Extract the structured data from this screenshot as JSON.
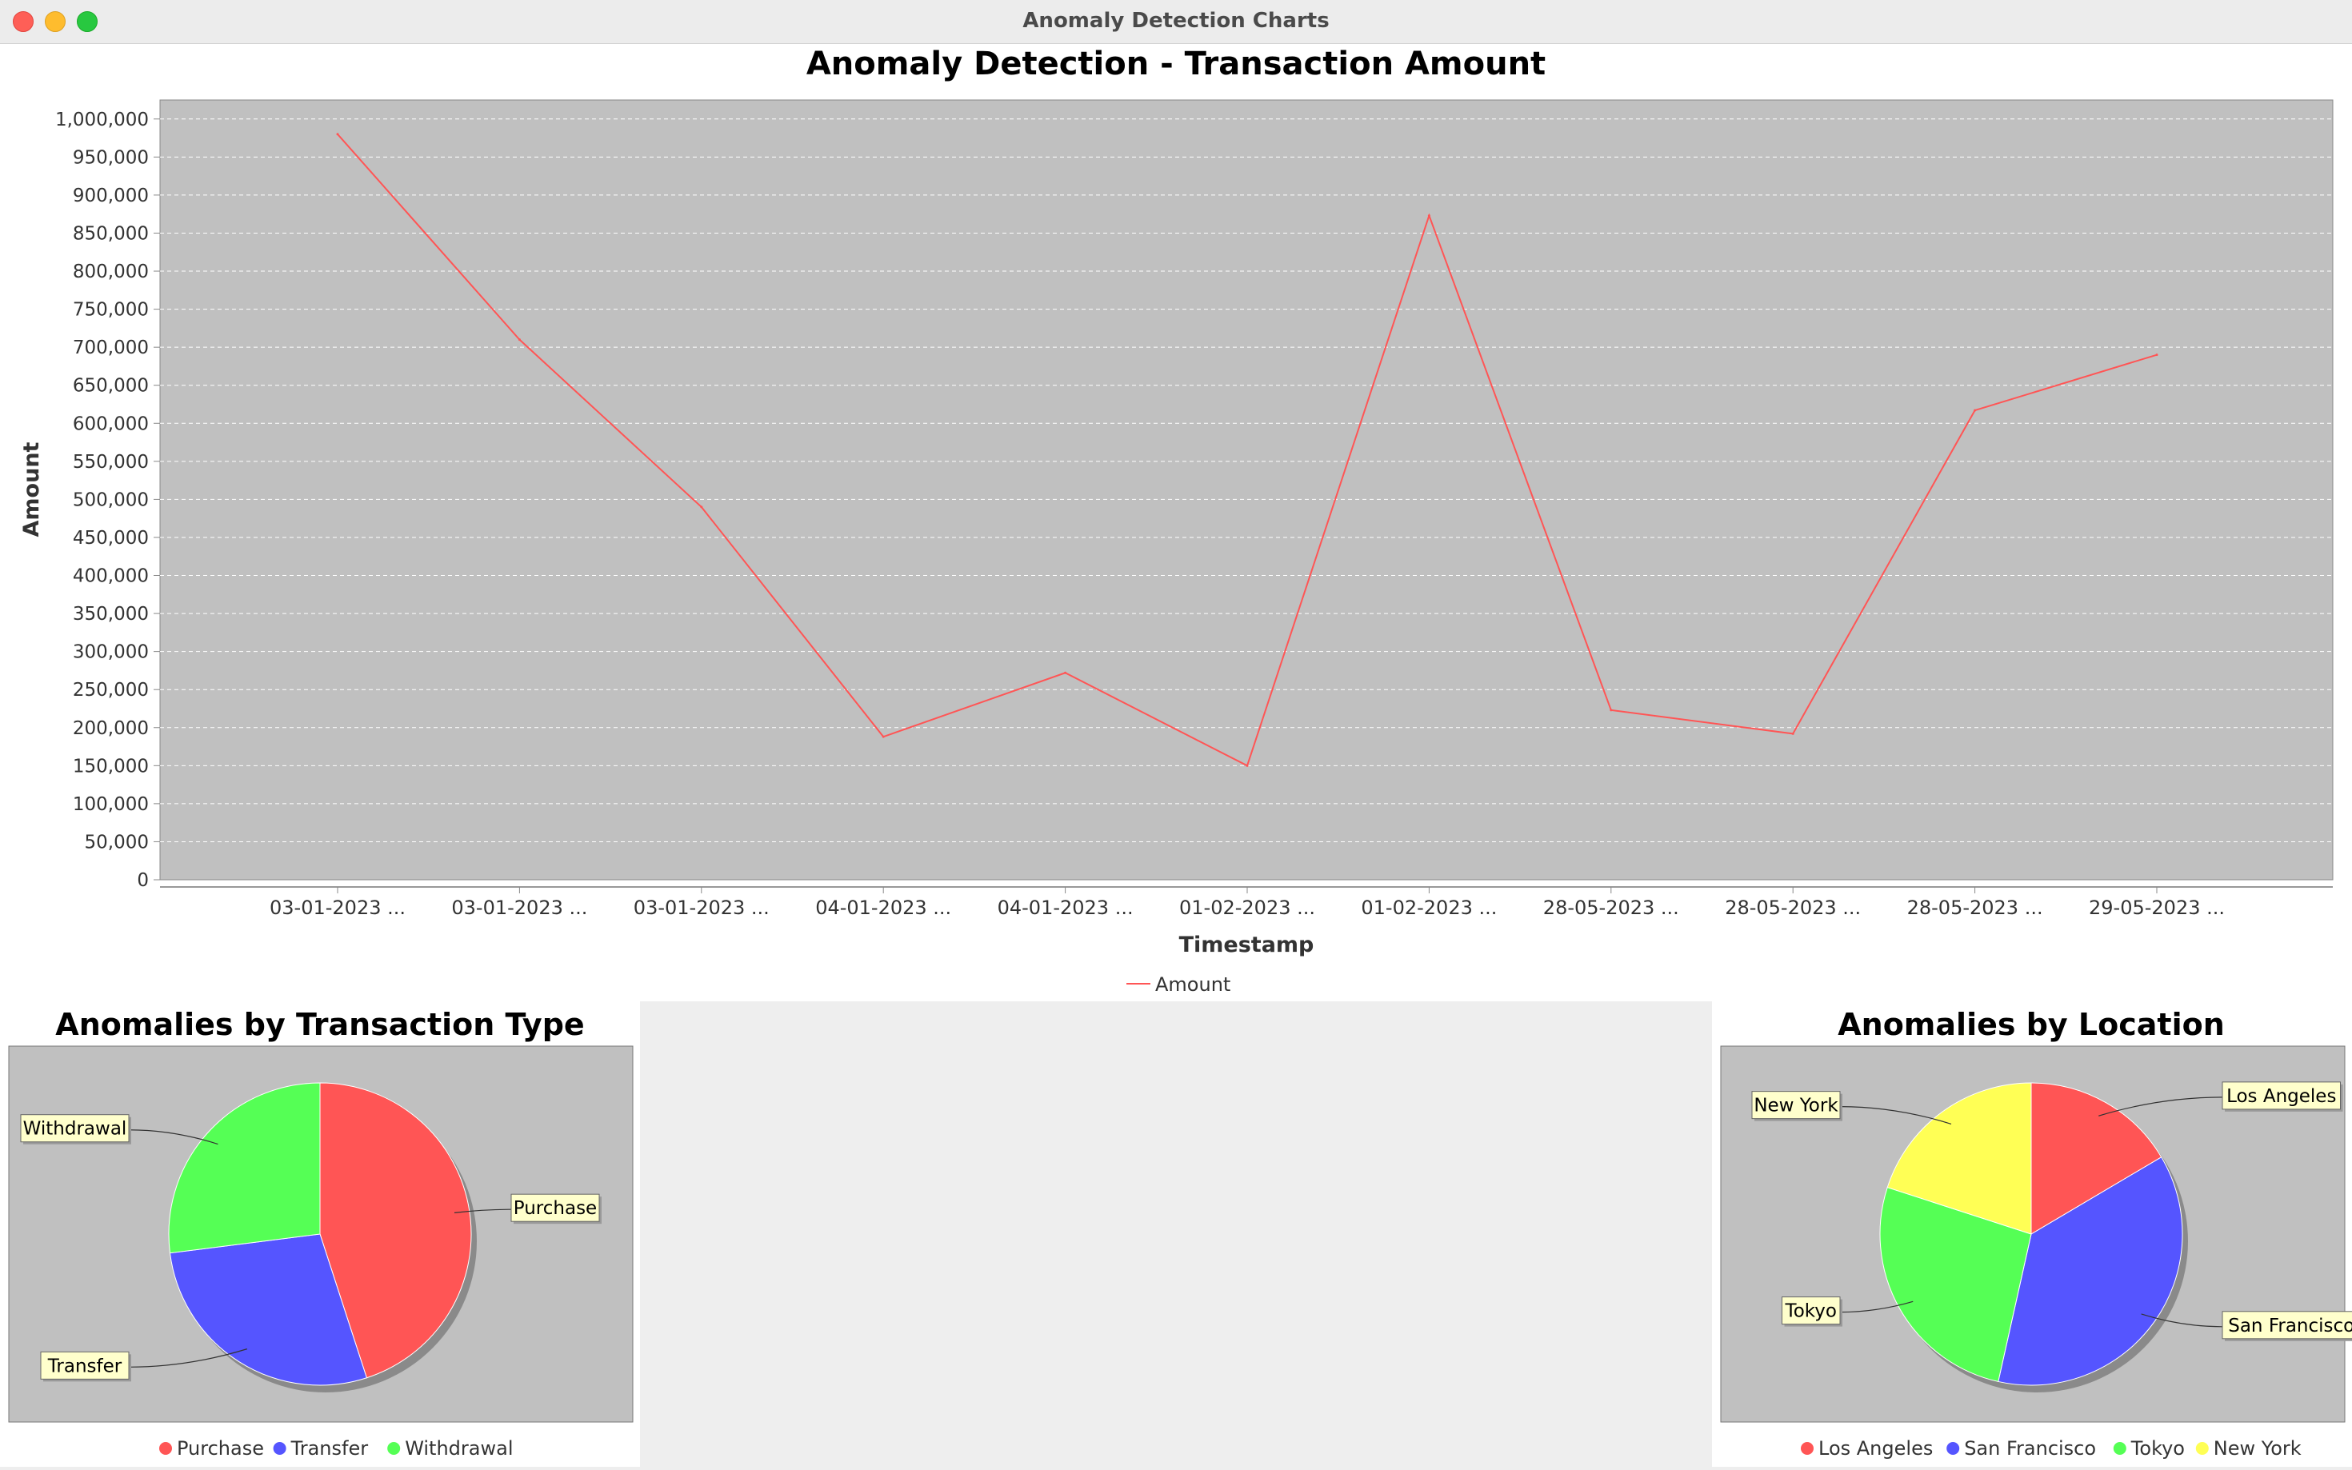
{
  "window": {
    "title": "Anomaly Detection Charts"
  },
  "colors": {
    "plot_background": "#c0c0c0",
    "line": "#ff5555",
    "purchase": "#ff5555",
    "transfer": "#5555ff",
    "withdrawal": "#55ff55",
    "new_york": "#ffff55",
    "label_box": "#ffffcc"
  },
  "chart_data": [
    {
      "type": "line",
      "title": "Anomaly Detection - Transaction Amount",
      "xlabel": "Timestamp",
      "ylabel": "Amount",
      "categories": [
        "03-01-2023 ...",
        "03-01-2023 ...",
        "03-01-2023 ...",
        "04-01-2023 ...",
        "04-01-2023 ...",
        "01-02-2023 ...",
        "01-02-2023 ...",
        "28-05-2023 ...",
        "28-05-2023 ...",
        "28-05-2023 ...",
        "29-05-2023 ..."
      ],
      "series": [
        {
          "name": "Amount",
          "values": [
            980000,
            710000,
            490000,
            188000,
            272000,
            150000,
            873000,
            223000,
            192000,
            617000,
            690000
          ]
        }
      ],
      "ylim": [
        0,
        1025000
      ],
      "yticks": [
        0,
        50000,
        100000,
        150000,
        200000,
        250000,
        300000,
        350000,
        400000,
        450000,
        500000,
        550000,
        600000,
        650000,
        700000,
        750000,
        800000,
        850000,
        900000,
        950000,
        1000000
      ],
      "ytick_labels": [
        "0",
        "50,000",
        "100,000",
        "150,000",
        "200,000",
        "250,000",
        "300,000",
        "350,000",
        "400,000",
        "450,000",
        "500,000",
        "550,000",
        "600,000",
        "650,000",
        "700,000",
        "750,000",
        "800,000",
        "850,000",
        "900,000",
        "950,000",
        "1,000,000"
      ],
      "grid": true,
      "legend": "bottom"
    },
    {
      "type": "pie",
      "title": "Anomalies by Transaction Type",
      "slices": [
        {
          "label": "Purchase",
          "value": 45
        },
        {
          "label": "Transfer",
          "value": 28
        },
        {
          "label": "Withdrawal",
          "value": 27
        }
      ],
      "legend": "bottom"
    },
    {
      "type": "pie",
      "title": "Anomalies by Location",
      "slices": [
        {
          "label": "Los Angeles",
          "value": 16.5
        },
        {
          "label": "San Francisco",
          "value": 37
        },
        {
          "label": "Tokyo",
          "value": 26.5
        },
        {
          "label": "New York",
          "value": 20
        }
      ],
      "legend": "bottom"
    }
  ]
}
